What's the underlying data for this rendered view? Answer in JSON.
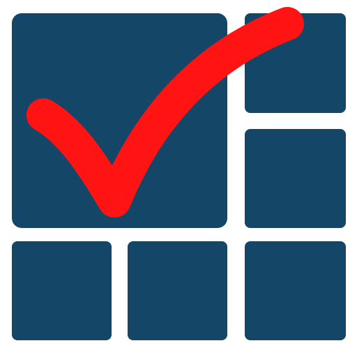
{
  "icon": {
    "name": "grid-checkmark-logo",
    "tile_color": "#134667",
    "check_color": "#ff1313",
    "background_color": "#ffffff"
  }
}
